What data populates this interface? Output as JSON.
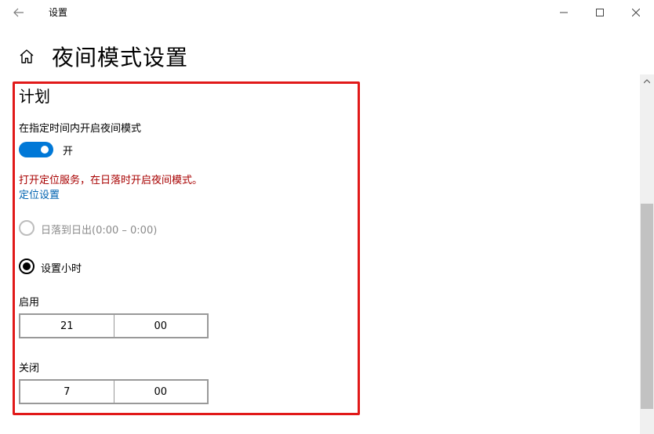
{
  "window": {
    "app_title": "设置"
  },
  "header": {
    "page_title": "夜间模式设置"
  },
  "schedule": {
    "section_title": "计划",
    "schedule_label": "在指定时间内开启夜间模式",
    "toggle_state": "开",
    "toggle_on": true,
    "location_note": "打开定位服务，在日落时开启夜间模式。",
    "location_link": "定位设置",
    "options": [
      {
        "label": "日落到日出(0:00 – 0:00)",
        "selected": false,
        "disabled": true
      },
      {
        "label": "设置小时",
        "selected": true,
        "disabled": false
      }
    ],
    "turn_on": {
      "label": "启用",
      "hour": "21",
      "minute": "00"
    },
    "turn_off": {
      "label": "关闭",
      "hour": "7",
      "minute": "00"
    }
  },
  "colors": {
    "accent": "#0078d7",
    "warning_text": "#a80000",
    "link": "#0063b1",
    "highlight_frame": "#e11919"
  },
  "icons": [
    "back-arrow-icon",
    "minimize-icon",
    "maximize-icon",
    "close-icon",
    "home-icon",
    "scroll-up-icon"
  ]
}
